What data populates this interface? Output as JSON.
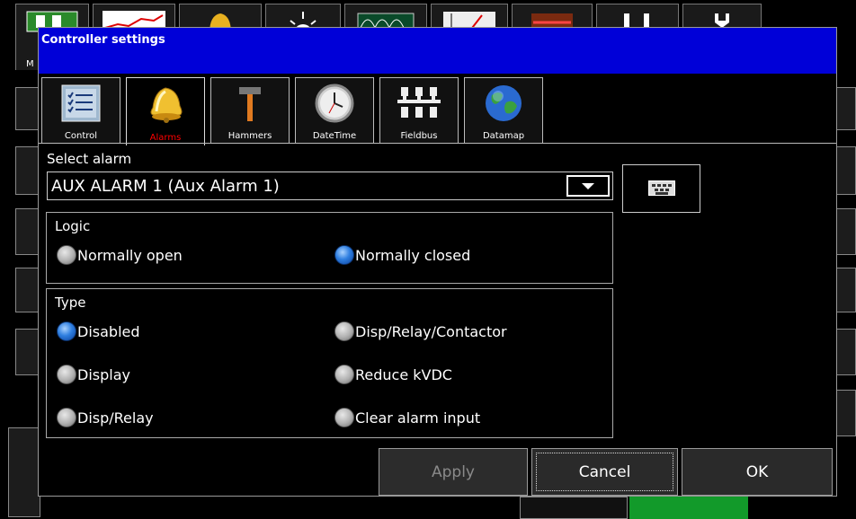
{
  "background_app": {
    "toolbar_letter": "M"
  },
  "dialog": {
    "title": "Controller settings",
    "title_bar_color": "#0000d8"
  },
  "tabs": [
    {
      "label": "Control",
      "icon": "checklist-icon",
      "active": false
    },
    {
      "label": "Alarms",
      "icon": "bell-icon",
      "active": true
    },
    {
      "label": "Hammers",
      "icon": "hammer-icon",
      "active": false
    },
    {
      "label": "DateTime",
      "icon": "clock-icon",
      "active": false
    },
    {
      "label": "Fieldbus",
      "icon": "network-icon",
      "active": false
    },
    {
      "label": "Datamap",
      "icon": "globe-icon",
      "active": false
    }
  ],
  "select_alarm": {
    "label": "Select alarm",
    "value": "AUX ALARM 1 (Aux Alarm 1)",
    "keyboard_icon": "keyboard-icon"
  },
  "logic": {
    "title": "Logic",
    "options": [
      {
        "label": "Normally open",
        "selected": false
      },
      {
        "label": "Normally closed",
        "selected": true
      }
    ]
  },
  "type": {
    "title": "Type",
    "options": [
      {
        "label": "Disabled",
        "selected": true
      },
      {
        "label": "Disp/Relay/Contactor",
        "selected": false
      },
      {
        "label": "Display",
        "selected": false
      },
      {
        "label": "Reduce kVDC",
        "selected": false
      },
      {
        "label": "Disp/Relay",
        "selected": false
      },
      {
        "label": "Clear alarm input",
        "selected": false
      }
    ]
  },
  "buttons": {
    "apply": "Apply",
    "cancel": "Cancel",
    "ok": "OK"
  },
  "colors": {
    "active_tab_label": "#ff0000",
    "radio_selected": "#2f7fe0",
    "disabled_text": "#8a8a8a"
  }
}
